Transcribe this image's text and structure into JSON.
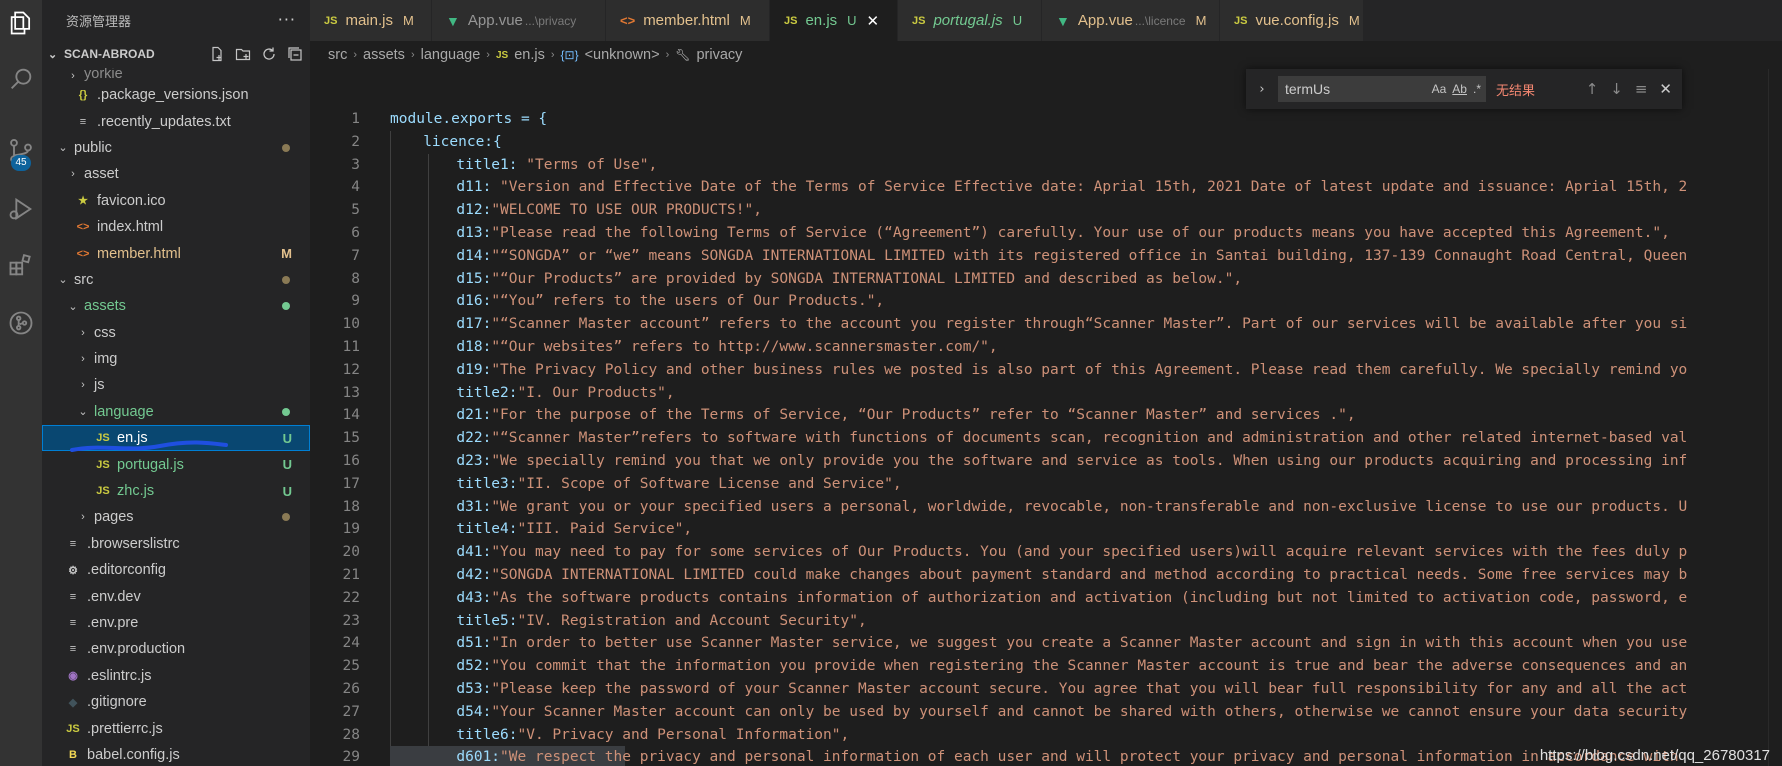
{
  "activity_bar": {
    "badge": "45",
    "icons": [
      "explorer-icon",
      "search-icon",
      "source-control-icon",
      "run-debug-icon",
      "extensions-icon",
      "remote-icon"
    ]
  },
  "sidebar": {
    "title": "资源管理器",
    "section": "SCAN-ABROAD",
    "items": [
      {
        "label": "yorkie",
        "kind": "folder",
        "indent": 1
      },
      {
        "label": ".package_versions.json",
        "kind": "json",
        "indent": 1
      },
      {
        "label": ".recently_updates.txt",
        "kind": "txt",
        "indent": 1
      },
      {
        "label": "public",
        "kind": "folder-open",
        "indent": 0,
        "dot": true
      },
      {
        "label": "asset",
        "kind": "folder",
        "indent": 1
      },
      {
        "label": "favicon.ico",
        "kind": "ico",
        "indent": 1
      },
      {
        "label": "index.html",
        "kind": "html",
        "indent": 1
      },
      {
        "label": "member.html",
        "kind": "html",
        "indent": 1,
        "status": "M"
      },
      {
        "label": "src",
        "kind": "folder-open",
        "indent": 0,
        "dot": true
      },
      {
        "label": "assets",
        "kind": "folder-open",
        "indent": 1,
        "dot": true,
        "green": true
      },
      {
        "label": "css",
        "kind": "folder",
        "indent": 2
      },
      {
        "label": "img",
        "kind": "folder",
        "indent": 2
      },
      {
        "label": "js",
        "kind": "folder",
        "indent": 2
      },
      {
        "label": "language",
        "kind": "folder-open",
        "indent": 2,
        "dot": true,
        "green": true
      },
      {
        "label": "en.js",
        "kind": "js",
        "indent": 3,
        "status": "U",
        "selected": true
      },
      {
        "label": "portugal.js",
        "kind": "js",
        "indent": 3,
        "status": "U",
        "green": true
      },
      {
        "label": "zhc.js",
        "kind": "js",
        "indent": 3,
        "status": "U",
        "green": true
      },
      {
        "label": "pages",
        "kind": "folder",
        "indent": 2,
        "dot": true
      },
      {
        "label": ".browserslistrc",
        "kind": "txt",
        "indent": 0
      },
      {
        "label": ".editorconfig",
        "kind": "gear",
        "indent": 0
      },
      {
        "label": ".env.dev",
        "kind": "txt",
        "indent": 0
      },
      {
        "label": ".env.pre",
        "kind": "txt",
        "indent": 0
      },
      {
        "label": ".env.production",
        "kind": "txt",
        "indent": 0
      },
      {
        "label": ".eslintrc.js",
        "kind": "eslint",
        "indent": 0
      },
      {
        "label": ".gitignore",
        "kind": "git",
        "indent": 0
      },
      {
        "label": ".prettierrc.js",
        "kind": "js",
        "indent": 0
      },
      {
        "label": "babel.config.js",
        "kind": "babel",
        "indent": 0
      }
    ]
  },
  "tabs": [
    {
      "label": "main.js",
      "icon": "js",
      "flag": "M"
    },
    {
      "label": "App.vue",
      "sub": "...\\privacy",
      "icon": "vue"
    },
    {
      "label": "member.html",
      "icon": "html",
      "flag": "M"
    },
    {
      "label": "en.js",
      "icon": "js",
      "flag": "U",
      "active": true
    },
    {
      "label": "portugal.js",
      "icon": "js",
      "flag": "U",
      "italic": true
    },
    {
      "label": "App.vue",
      "sub": "...\\licence",
      "icon": "vue",
      "flag": "M"
    },
    {
      "label": "vue.config.js",
      "icon": "js",
      "flag": "M"
    }
  ],
  "breadcrumb": [
    "src",
    "assets",
    "language",
    "en.js",
    "<unknown>",
    "privacy"
  ],
  "find": {
    "value": "termUs",
    "options": [
      "Aa",
      "Ab",
      ".*"
    ],
    "result": "无结果"
  },
  "code_lines": [
    {
      "n": "1",
      "k": "module.exports = {",
      "v": ""
    },
    {
      "n": "2",
      "k": "licence:{",
      "v": ""
    },
    {
      "n": "3",
      "k": "title1: ",
      "v": "\"Terms of Use\","
    },
    {
      "n": "4",
      "k": "d11: ",
      "v": "\"Version and Effective Date of the Terms of Service Effective date: Aprial 15th, 2021 Date of latest update and issuance: Aprial 15th, 2"
    },
    {
      "n": "5",
      "k": "d12:",
      "v": "\"WELCOME TO USE OUR PRODUCTS!\","
    },
    {
      "n": "6",
      "k": "d13:",
      "v": "\"Please read the following Terms of Service (“Agreement”) carefully. Your use of our products means you have accepted this Agreement.\","
    },
    {
      "n": "7",
      "k": "d14:",
      "v": "\"“SONGDA” or “we” means SONGDA INTERNATIONAL LIMITED with its registered office in Santai building, 137-139 Connaught Road Central, Queen"
    },
    {
      "n": "8",
      "k": "d15:",
      "v": "\"“Our Products” are provided by SONGDA INTERNATIONAL LIMITED and described as below.\","
    },
    {
      "n": "9",
      "k": "d16:",
      "v": "\"“You” refers to the users of Our Products.\","
    },
    {
      "n": "10",
      "k": "d17:",
      "v": "\"“Scanner Master account” refers to the account you register through“Scanner Master”. Part of our services will be available after you si"
    },
    {
      "n": "11",
      "k": "d18:",
      "v": "\"“Our websites” refers to http://www.scannersmaster.com/\","
    },
    {
      "n": "12",
      "k": "d19:",
      "v": "\"The Privacy Policy and other business rules we posted is also part of this Agreement. Please read them carefully. We specially remind yo"
    },
    {
      "n": "13",
      "k": "title2:",
      "v": "\"I. Our Products\","
    },
    {
      "n": "14",
      "k": "d21:",
      "v": "\"For the purpose of the Terms of Service, “Our Products” refer to “Scanner Master” and services .\","
    },
    {
      "n": "15",
      "k": "d22:",
      "v": "\"“Scanner Master”refers to software with functions of documents scan, recognition and administration and other related internet-based val"
    },
    {
      "n": "16",
      "k": "d23:",
      "v": "\"We specially remind you that we only provide you the software and service as tools. When using our products acquiring and processing inf"
    },
    {
      "n": "17",
      "k": "title3:",
      "v": "\"II. Scope of Software License and Service\","
    },
    {
      "n": "18",
      "k": "d31:",
      "v": "\"We grant you or your specified users a personal, worldwide, revocable, non-transferable and non-exclusive license to use our products. U"
    },
    {
      "n": "19",
      "k": "title4:",
      "v": "\"III. Paid Service\","
    },
    {
      "n": "20",
      "k": "d41:",
      "v": "\"You may need to pay for some services of Our Products. You (and your specified users)will acquire relevant services with the fees duly p"
    },
    {
      "n": "21",
      "k": "d42:",
      "v": "\"SONGDA INTERNATIONAL LIMITED could make changes about payment standard and method according to practical needs. Some free services may b"
    },
    {
      "n": "22",
      "k": "d43:",
      "v": "\"As the software products contains information of authorization and activation (including but not limited to activation code, password, e"
    },
    {
      "n": "23",
      "k": "title5:",
      "v": "\"IV. Registration and Account Security\","
    },
    {
      "n": "24",
      "k": "d51:",
      "v": "\"In order to better use Scanner Master service, we suggest you create a Scanner Master account and sign in with this account when you use"
    },
    {
      "n": "25",
      "k": "d52:",
      "v": "\"You commit that the information you provide when registering the Scanner Master account is true and bear the adverse consequences and an"
    },
    {
      "n": "26",
      "k": "d53:",
      "v": "\"Please keep the password of your Scanner Master account secure. You agree that you will bear full responsibility for any and all the act"
    },
    {
      "n": "27",
      "k": "d54:",
      "v": "\"Your Scanner Master account can only be used by yourself and cannot be shared with others, otherwise we cannot ensure your data security"
    },
    {
      "n": "28",
      "k": "title6:",
      "v": "\"V. Privacy and Personal Information\","
    },
    {
      "n": "29",
      "k": "d601:",
      "v": "\"We respect the privacy and personal information of each user and will protect your privacy and personal information in accordance with "
    }
  ],
  "watermark": "https://blog.csdn.net/qq_26780317",
  "colors": {
    "accent": "#007fd4",
    "selected": "#094771",
    "untracked": "#73c991",
    "modified": "#e2c08d",
    "no_results": "#f48771"
  }
}
